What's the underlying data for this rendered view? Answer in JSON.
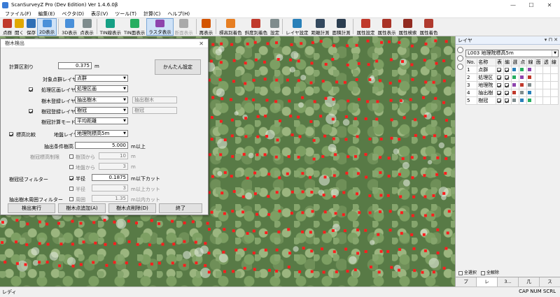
{
  "window": {
    "title": "ScanSurveyZ Pro  (Dev Edition)  Ver 1.4.6.0β",
    "minimize": "—",
    "maximize": "☐",
    "close": "✕"
  },
  "menu": [
    "ファイル(F)",
    "編集(E)",
    "ベクタ(D)",
    "表示(V)",
    "ツール(T)",
    "計算(C)",
    "ヘルプ(H)"
  ],
  "toolbar": [
    {
      "label": "点群",
      "color": "#c0392b"
    },
    {
      "label": "開く",
      "color": "#e0a800"
    },
    {
      "label": "保存",
      "color": "#2f6fb5"
    },
    {
      "label": "2D表示",
      "color": "#4a90d9",
      "active": true
    },
    {
      "label": "3D表示",
      "color": "#4a90d9"
    },
    {
      "label": "点表示",
      "color": "#7f8c8d"
    },
    {
      "label": "TIN線表示",
      "color": "#16a085"
    },
    {
      "label": "TIN面表示",
      "color": "#27ae60"
    },
    {
      "label": "ラスタ表示",
      "color": "#8e44ad",
      "active": true
    },
    {
      "label": "断面表示",
      "color": "#aaaaaa",
      "disabled": true
    },
    {
      "label": "再表示",
      "color": "#d35400"
    },
    {
      "label": "標高別着色",
      "color": "#e67e22"
    },
    {
      "label": "斜度別着色",
      "color": "#c0392b"
    },
    {
      "label": "設定",
      "color": "#7f8c8d"
    },
    {
      "label": "レイヤ設定",
      "color": "#2980b9"
    },
    {
      "label": "距離計測",
      "color": "#34495e"
    },
    {
      "label": "面積計測",
      "color": "#2c3e50"
    },
    {
      "label": "属性設定",
      "color": "#c0392b"
    },
    {
      "label": "属性表示",
      "color": "#a93226"
    },
    {
      "label": "属性検索",
      "color": "#922b21"
    },
    {
      "label": "属性着色",
      "color": "#b03a2e"
    }
  ],
  "layer_panel": {
    "title": "レイヤ",
    "header_buttons": "▾ ⊓ ✕",
    "selected_layer": "L003 地理院標高5m",
    "columns": [
      "No.",
      "名称",
      "表",
      "編",
      "選",
      "点",
      "線",
      "面",
      "透",
      "線"
    ],
    "rows": [
      {
        "no": "1",
        "name": "点群"
      },
      {
        "no": "2",
        "name": "処理区"
      },
      {
        "no": "3",
        "name": "地理院"
      },
      {
        "no": "4",
        "name": "抽出樹"
      },
      {
        "no": "5",
        "name": "樹冠"
      }
    ],
    "filter_all": "全選択",
    "filter_clear": "全解除",
    "tabs": [
      "プ",
      "レ",
      "3...",
      "几",
      "ス"
    ]
  },
  "status": {
    "left": "レディ",
    "right": "CAP  NUM  SCRL"
  },
  "dialog": {
    "title": "樹木検出",
    "close": "✕",
    "calc_interval_label": "計算区割り",
    "calc_interval_value": "0.375",
    "calc_interval_unit": "m",
    "easy_settings": "かんたん設定",
    "target_points_label": "対象点群レイヤ",
    "target_points_value": "点群",
    "process_area_label": "処理区画レイヤ",
    "process_area_value": "処理区画",
    "tree_reg_label": "樹木登録レイヤ",
    "tree_reg_value": "抽出樹木",
    "tree_reg_field": "抽出樹木",
    "crown_reg_label": "樹冠登録レイヤ",
    "crown_reg_value": "樹冠",
    "crown_reg_field": "樹冠",
    "crown_calc_label": "樹冠計算モード",
    "crown_calc_value": "平均距離",
    "elev_compare_label": "標高比較",
    "ground_layer_label": "地盤レイヤ",
    "ground_layer_value": "地理院標高5m",
    "extract_cond_label": "抽出条件",
    "tree_height_label": "樹高",
    "tree_height_value": "5.000",
    "tree_height_unit": "m以上",
    "crown_elev_limit_label": "樹冠標高制限",
    "from_tree_top_label": "樹頂から",
    "from_tree_top_value": "10",
    "from_tree_top_unit": "m",
    "from_ground_label": "地盤から",
    "from_ground_value": "3",
    "from_ground_unit": "m",
    "crown_diam_filter_label": "樹冠径フィルター",
    "radius_label": "半径",
    "radius_value": "0.1875",
    "radius_unit": "m以下カット",
    "diameter_label": "半径",
    "diameter_value": "3",
    "diameter_unit": "m以上カット",
    "perimeter_filter_label": "抽出樹木周囲フィルター",
    "perimeter_label": "周囲",
    "perimeter_value": "1.35",
    "perimeter_unit": "m以内カット",
    "run_button": "検出実行",
    "add_button": "樹木点追加(A)",
    "delete_button": "樹木点削除(D)",
    "end_button": "終了"
  }
}
